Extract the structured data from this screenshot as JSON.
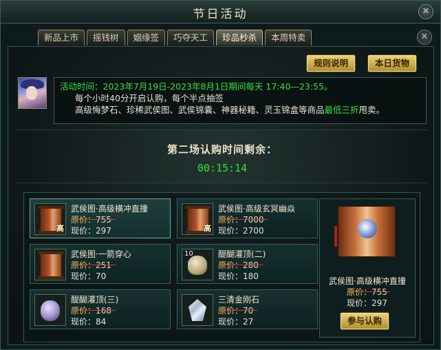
{
  "window": {
    "title": "节日活动",
    "close_glyph": "✕"
  },
  "tabs": [
    {
      "label": "新品上市",
      "active": false
    },
    {
      "label": "摇钱树",
      "active": false
    },
    {
      "label": "姻缘签",
      "active": false
    },
    {
      "label": "巧夺天工",
      "active": false
    },
    {
      "label": "珍品秒杀",
      "active": true
    },
    {
      "label": "本周特卖",
      "active": false
    }
  ],
  "buttons": {
    "rules": "规则说明",
    "today_goods": "本日货物",
    "join": "参与认购"
  },
  "activity": {
    "time_label": "活动时间：",
    "time_text": "2023年7月19日-2023年8月1日期间每天 17:40—23:55。",
    "line2": "每个小时40分开启认购，每个半点抽签",
    "line3_pre": "高级悔梦石、珍稀武侯图、武侯锦囊、神器秘籍、灵玉锦盒等商品",
    "line3_highlight": "最低三折",
    "line3_post": "甩卖。"
  },
  "countdown": {
    "label": "第二场认购时间剩余：",
    "time": "00:15:14"
  },
  "price_labels": {
    "original": "原价：",
    "current": "现价："
  },
  "items": [
    {
      "name": "武侯图·高级横冲直撞",
      "original": "755",
      "current": "297",
      "icon": "scroll-icon",
      "badge": "高",
      "selected": true
    },
    {
      "name": "武侯图·高级玄冥幽焱",
      "original": "7000",
      "current": "2700",
      "icon": "scroll-icon",
      "badge": "高",
      "selected": false
    },
    {
      "name": "武侯图·一箭穿心",
      "original": "251",
      "current": "70",
      "icon": "scroll-icon",
      "badge": "",
      "selected": false
    },
    {
      "name": "醍醐灌顶(二)",
      "original": "280",
      "current": "180",
      "icon": "jar-icon",
      "badge": "10",
      "selected": false
    },
    {
      "name": "醍醐灌顶(三)",
      "original": "168",
      "current": "84",
      "icon": "jar-icon",
      "badge": "",
      "selected": false
    },
    {
      "name": "三清金刚石",
      "original": "70",
      "current": "27",
      "icon": "diamond-icon",
      "badge": "",
      "selected": false
    }
  ],
  "preview": {
    "name": "武侯图·高级横冲直撞",
    "original": "755",
    "current": "297"
  }
}
